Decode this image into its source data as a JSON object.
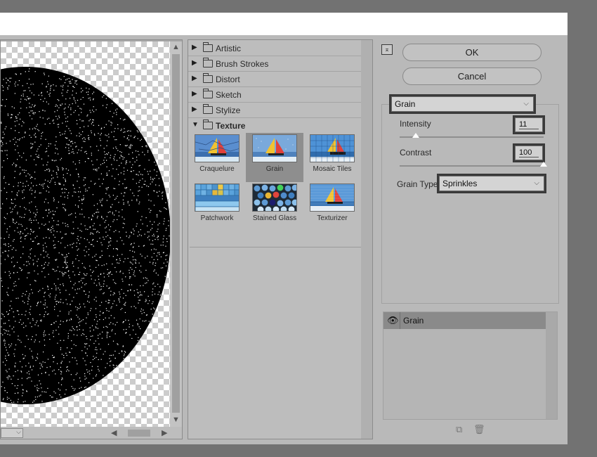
{
  "dialog": {
    "buttons": {
      "ok": "OK",
      "cancel": "Cancel"
    }
  },
  "gallery": {
    "categories": [
      {
        "label": "Artistic"
      },
      {
        "label": "Brush Strokes"
      },
      {
        "label": "Distort"
      },
      {
        "label": "Sketch"
      },
      {
        "label": "Stylize"
      },
      {
        "label": "Texture"
      }
    ],
    "thumbnails": [
      {
        "label": "Craquelure"
      },
      {
        "label": "Grain"
      },
      {
        "label": "Mosaic Tiles"
      },
      {
        "label": "Patchwork"
      },
      {
        "label": "Stained Glass"
      },
      {
        "label": "Texturizer"
      }
    ],
    "selected_thumbnail": "Grain"
  },
  "settings": {
    "filter_select": "Grain",
    "intensity": {
      "label": "Intensity",
      "value": "11",
      "fraction": 0.11
    },
    "contrast": {
      "label": "Contrast",
      "value": "100",
      "fraction": 1.0
    },
    "grain_type": {
      "label": "Grain Type:",
      "value": "Sprinkles"
    }
  },
  "layers": {
    "items": [
      {
        "name": "Grain"
      }
    ]
  },
  "icons": {
    "collapse": "collapse-up-icon",
    "eye": "eye-icon",
    "new_layer": "new-effect-layer-icon",
    "delete": "trash-icon",
    "folder": "folder-icon"
  }
}
